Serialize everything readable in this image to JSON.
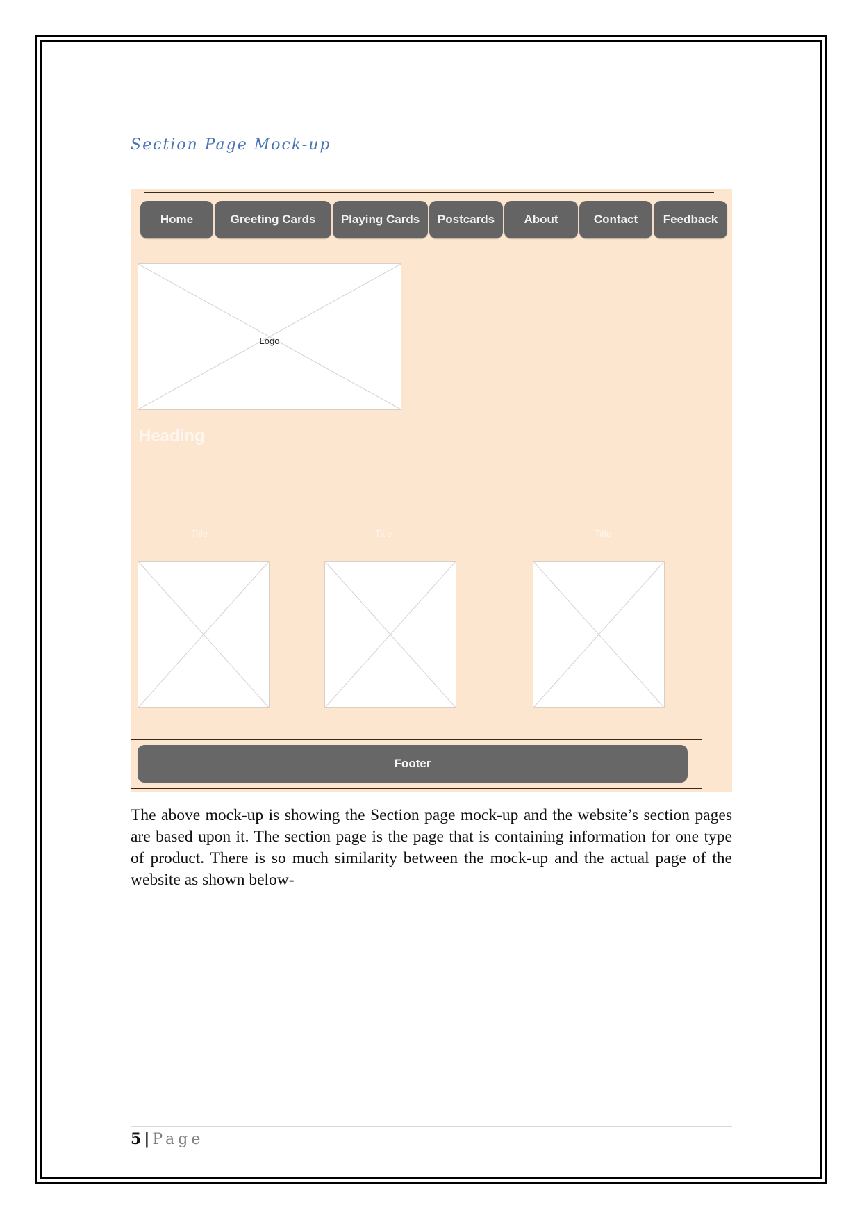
{
  "section_heading": "Section Page Mock-up",
  "mockup": {
    "nav_items": [
      {
        "label": "Home"
      },
      {
        "label": "Greeting Cards"
      },
      {
        "label": "Playing Cards"
      },
      {
        "label": "Postcards"
      },
      {
        "label": "About"
      },
      {
        "label": "Contact"
      },
      {
        "label": "Feedback"
      }
    ],
    "logo_label": "Logo",
    "heading": "Heading",
    "titles": [
      "Title",
      "Title",
      "Title"
    ],
    "footer_label": "Footer",
    "colors": {
      "background": "#fde6cf",
      "button": "#646464",
      "placeholder": "#ffffff"
    }
  },
  "body_paragraph": "The above mock-up is showing the Section page mock-up and the website’s section pages are based upon it. The section page is the page that is containing information for one type of product. There is so much similarity between the mock-up and the actual page of the website as shown below-",
  "footer": {
    "page_number": "5",
    "separator": "|",
    "page_word": "Page"
  },
  "colors": {
    "heading": "#4a75b5"
  }
}
